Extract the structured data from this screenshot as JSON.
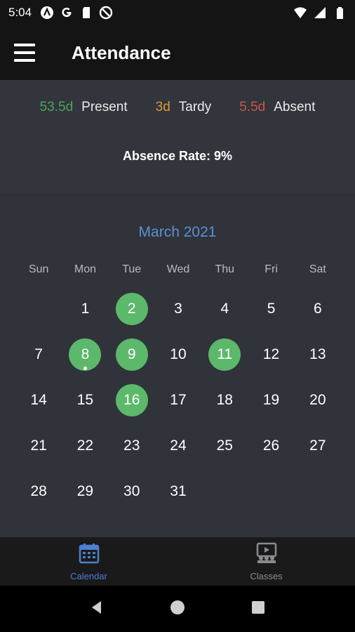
{
  "status_bar": {
    "time": "5:04",
    "left_icons": [
      "app-a-icon",
      "google-icon",
      "sd-card-icon",
      "no-sync-icon"
    ],
    "right_icons": [
      "wifi-icon",
      "signal-icon",
      "battery-icon"
    ]
  },
  "app_bar": {
    "title": "Attendance"
  },
  "summary": {
    "present_value": "53.5d",
    "present_label": "Present",
    "tardy_value": "3d",
    "tardy_label": "Tardy",
    "absent_value": "5.5d",
    "absent_label": "Absent",
    "absence_rate": "Absence Rate: 9%"
  },
  "calendar": {
    "month": "March 2021",
    "weekdays": [
      "Sun",
      "Mon",
      "Tue",
      "Wed",
      "Thu",
      "Fri",
      "Sat"
    ],
    "leading_blanks": 1,
    "days": 31,
    "present_days": [
      2,
      8,
      9,
      11,
      16
    ],
    "dot_days": [
      8
    ]
  },
  "bottom_nav": {
    "calendar_label": "Calendar",
    "classes_label": "Classes"
  },
  "colors": {
    "present": "#4fa35b",
    "tardy": "#d79a3a",
    "absent": "#c9564a",
    "accent": "#4b7fd0",
    "circle": "#5cb86a"
  }
}
